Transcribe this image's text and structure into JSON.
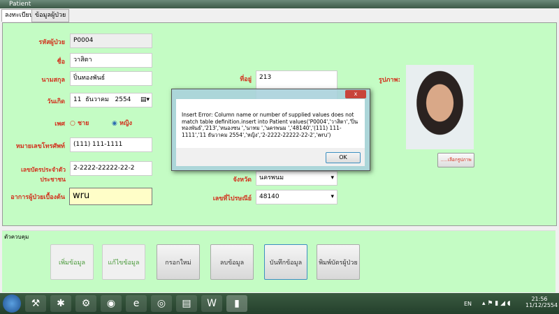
{
  "window": {
    "title": "Patient"
  },
  "tabs": [
    {
      "label": "ลงทะเบียน"
    },
    {
      "label": "ข้อมูลผู้ป่วย"
    }
  ],
  "form": {
    "patient_id": {
      "label": "รหัสผู้ป่วย",
      "value": "P0004"
    },
    "first_name": {
      "label": "ชื่อ",
      "value": "วาสิตา"
    },
    "last_name": {
      "label": "นามสกุล",
      "value": "ปิ่นทองพันธ์"
    },
    "birthdate": {
      "label": "วันเกิด",
      "day": "11",
      "month": "ธันวาคม",
      "year": "2554"
    },
    "gender": {
      "label": "เพศ",
      "male": "ชาย",
      "female": "หญิง",
      "selected": "หญิง"
    },
    "phone": {
      "label": "หมายเลขโทรศัพท์",
      "value": "(111) 111-1111"
    },
    "id_card": {
      "label": "เลขบัตรประจำตัวประชาชน",
      "value": "2-2222-22222-22-2"
    },
    "symptom": {
      "label": "อาการผู้ป่วยเบื้องต้น",
      "value": "wru"
    },
    "address": {
      "label": "ที่อยู่",
      "value": "213"
    },
    "province": {
      "label": "จังหวัด",
      "value": "นครพนม"
    },
    "postcode": {
      "label": "เลขที่ไปรษณีย์",
      "value": "48140"
    },
    "photo": {
      "label": "รูปภาพ:",
      "button": ".....เลือกรูปภาพ"
    }
  },
  "controls": {
    "group_label": "ตัวควบคุม",
    "buttons": [
      "เพิ่มข้อมูล",
      "แก้ไขข้อมูล",
      "กรอกใหม่",
      "ลบข้อมูล",
      "บันทึกข้อมูล",
      "พิมพ์บัตรผู้ป่วย"
    ]
  },
  "dialog": {
    "message": "Insert Error: Column name or number of supplied values does not match table definition.insert into Patient values('P0004','วาสิตา','ปิ่นทองพันธ์','213','หนองซน ','นาทม ','นครพนม ','48140','(111) 111-1111','11 ธันวาคม 2554','หญิง','2-2222-22222-22-2','wru')",
    "ok": "OK",
    "close": "x"
  },
  "taskbar": {
    "lang": "EN",
    "time": "21:56",
    "date": "11/12/2554"
  }
}
